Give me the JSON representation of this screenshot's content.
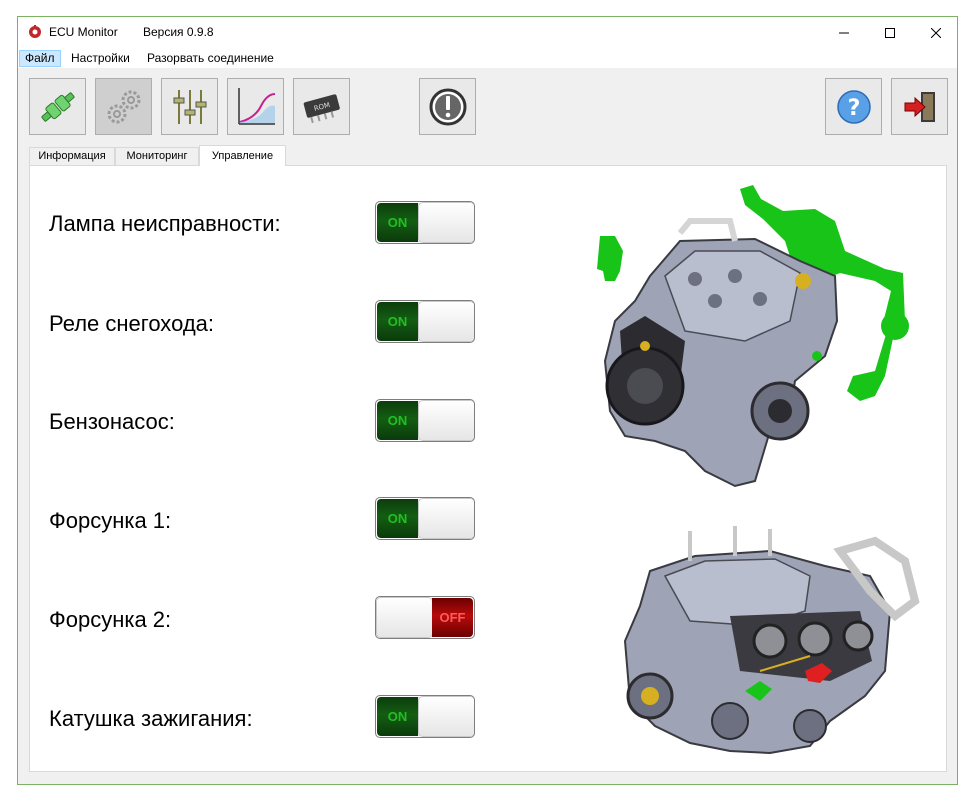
{
  "window": {
    "app_title": "ECU Monitor",
    "version": "Версия 0.9.8"
  },
  "menu": {
    "items": [
      "Файл",
      "Настройки",
      "Разорвать соединение"
    ]
  },
  "toolbar": {
    "buttons": [
      "connector-icon",
      "settings-gears-icon",
      "sliders-icon",
      "chart-icon",
      "rom-chip-icon",
      "alert-icon",
      "help-icon",
      "exit-icon"
    ]
  },
  "tabs": [
    "Информация",
    "Мониторинг",
    "Управление"
  ],
  "active_tab": "Управление",
  "controls": [
    {
      "label": "Лампа неисправности:",
      "state": "ON"
    },
    {
      "label": "Реле снегохода:",
      "state": "ON"
    },
    {
      "label": "Бензонасос:",
      "state": "ON"
    },
    {
      "label": "Форсунка 1:",
      "state": "ON"
    },
    {
      "label": "Форсунка 2:",
      "state": "OFF"
    },
    {
      "label": "Катушка зажигания:",
      "state": "ON"
    }
  ],
  "colors": {
    "on": "#135e13",
    "off": "#b80b0b",
    "highlight_green": "#19c419",
    "highlight_red": "#e02020"
  }
}
